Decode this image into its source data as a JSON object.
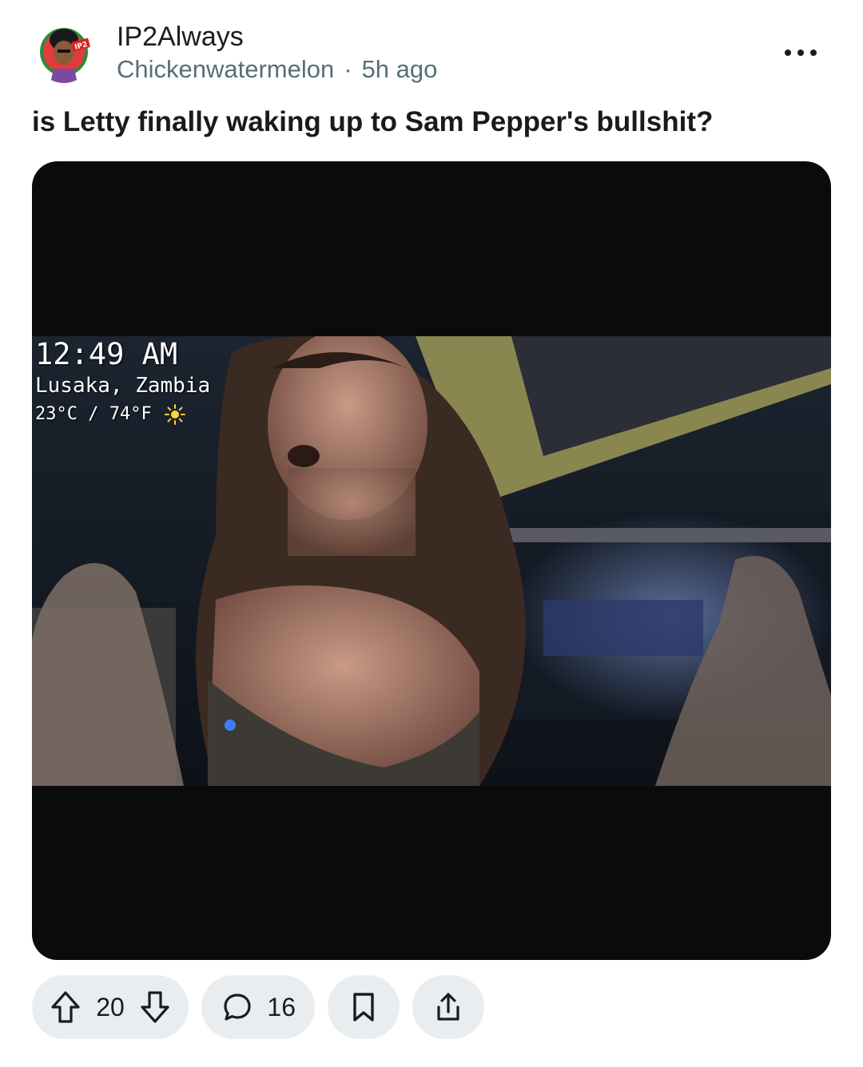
{
  "post": {
    "community": "IP2Always",
    "author": "Chickenwatermelon",
    "separator": "·",
    "age": "5h ago",
    "title": "is Letty finally waking up to Sam Pepper's bullshit?"
  },
  "avatar": {
    "badge_text": "IP2",
    "icon": "avatar-icon"
  },
  "video_overlay": {
    "time": "12:49 AM",
    "location": "Lusaka, Zambia",
    "temperature": "23°C / 74°F",
    "weather_icon": "sun-icon"
  },
  "actions": {
    "upvote_icon": "upvote-arrow-icon",
    "score": "20",
    "downvote_icon": "downvote-arrow-icon",
    "comment_icon": "comment-bubble-icon",
    "comment_count": "16",
    "save_icon": "bookmark-icon",
    "share_icon": "share-icon"
  },
  "colors": {
    "pill_background": "#eaedef",
    "meta_text": "#576f76",
    "media_background": "#0b0b0b"
  }
}
